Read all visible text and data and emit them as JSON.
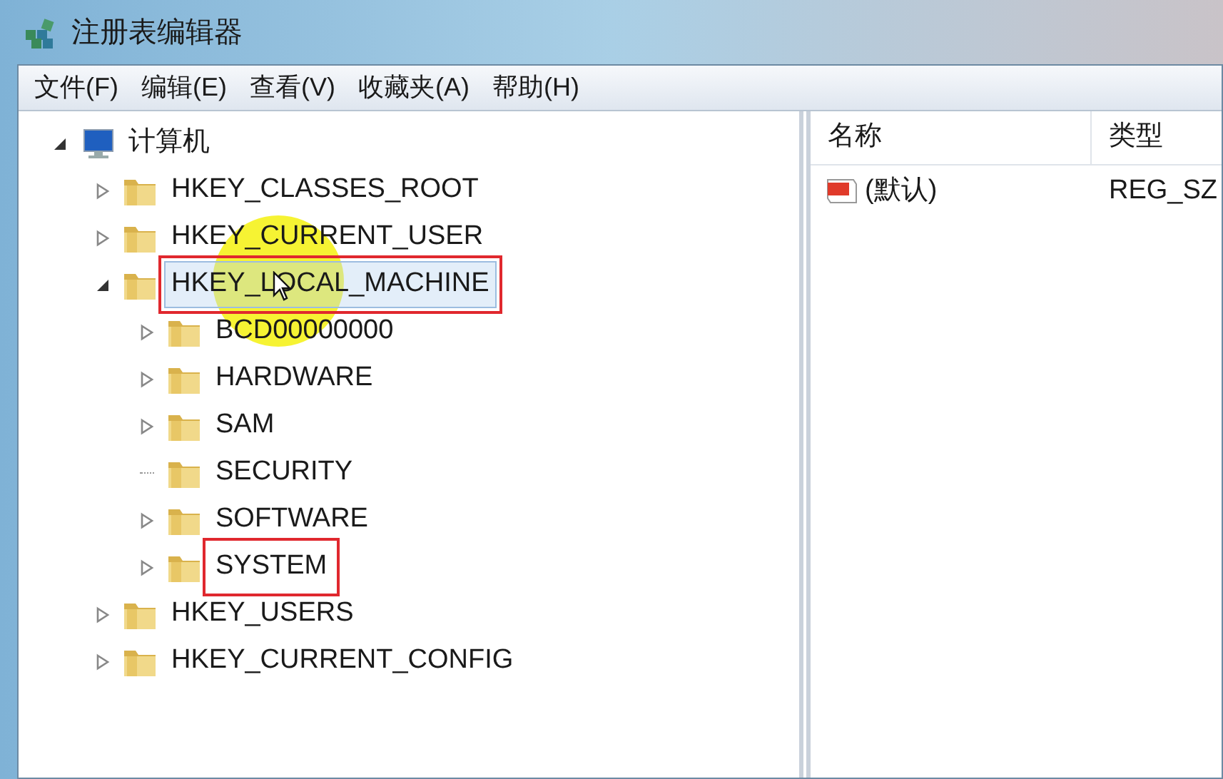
{
  "window": {
    "title": "注册表编辑器"
  },
  "menu": [
    "文件(F)",
    "编辑(E)",
    "查看(V)",
    "收藏夹(A)",
    "帮助(H)"
  ],
  "tree": {
    "label": "计算机",
    "expandable": true,
    "expanded": true,
    "children": [
      {
        "label": "HKEY_CLASSES_ROOT",
        "expandable": true,
        "expanded": false,
        "selected": false,
        "annotated": false
      },
      {
        "label": "HKEY_CURRENT_USER",
        "expandable": true,
        "expanded": false,
        "selected": false,
        "annotated": false
      },
      {
        "label": "HKEY_LOCAL_MACHINE",
        "expandable": true,
        "expanded": true,
        "selected": true,
        "annotated": true,
        "children": [
          {
            "label": "BCD00000000",
            "expandable": true,
            "expanded": false,
            "selected": false,
            "annotated": false
          },
          {
            "label": "HARDWARE",
            "expandable": true,
            "expanded": false,
            "selected": false,
            "annotated": false
          },
          {
            "label": "SAM",
            "expandable": true,
            "expanded": false,
            "selected": false,
            "annotated": false
          },
          {
            "label": "SECURITY",
            "expandable": false,
            "expanded": false,
            "selected": false,
            "annotated": false
          },
          {
            "label": "SOFTWARE",
            "expandable": true,
            "expanded": false,
            "selected": false,
            "annotated": false
          },
          {
            "label": "SYSTEM",
            "expandable": true,
            "expanded": false,
            "selected": false,
            "annotated": true
          }
        ]
      },
      {
        "label": "HKEY_USERS",
        "expandable": true,
        "expanded": false,
        "selected": false,
        "annotated": false
      },
      {
        "label": "HKEY_CURRENT_CONFIG",
        "expandable": true,
        "expanded": false,
        "selected": false,
        "annotated": false
      }
    ]
  },
  "values": {
    "columns": [
      "名称",
      "类型"
    ],
    "rows": [
      {
        "name": "(默认)",
        "type": "REG_SZ"
      }
    ]
  }
}
